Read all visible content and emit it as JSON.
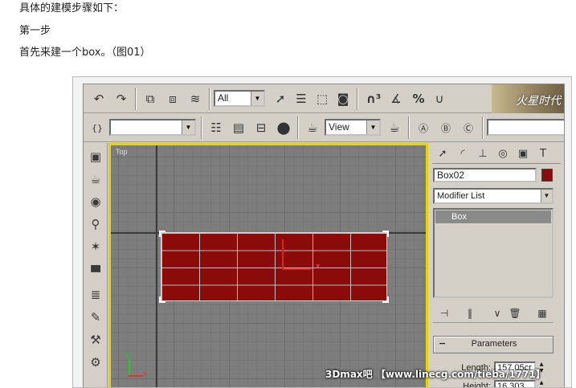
{
  "article": {
    "line1": "具体的建模步骤如下：",
    "line2": "第一步",
    "line3": "首先来建一个box。（图01）"
  },
  "toolbar1": {
    "selection_filter": "All",
    "icons": [
      "undo-icon",
      "redo-icon",
      "link-icon",
      "unlink-icon",
      "bind-space-warp-icon",
      "select-object-icon",
      "select-by-name-icon",
      "rectangular-selection-icon",
      "window-crossing-icon",
      "snap-3d-icon",
      "angle-snap-icon",
      "percent-snap-icon",
      "spinner-snap-icon"
    ],
    "logo_text": "火星时代"
  },
  "toolbar2": {
    "named_selection": "",
    "view_dropdown": "View",
    "icons": [
      "named-sets-icon",
      "layers-icon",
      "track-view-icon",
      "schematic-view-icon",
      "material-editor-icon",
      "render-scene-icon",
      "quick-render-icon",
      "named-selection-a-icon",
      "named-selection-b-icon",
      "named-selection-c-icon"
    ]
  },
  "left_strip": {
    "icons": [
      "box-primitive-icon",
      "teapot-icon",
      "sphere-icon",
      "pin-icon",
      "star-icon",
      "wall-icon",
      "stack-icon",
      "pencil-icon",
      "hammer-icon",
      "gear-icon"
    ]
  },
  "viewport": {
    "label": "Top",
    "axis_x": "x",
    "axis_y": "y",
    "pivot_label": "x"
  },
  "command_panel": {
    "tabs": [
      "create-tab-icon",
      "modify-tab-icon",
      "hierarchy-tab-icon",
      "motion-tab-icon",
      "display-tab-icon",
      "utilities-tab-icon"
    ],
    "object_name": "Box02",
    "object_color": "#8b0a0a",
    "modifier_list_label": "Modifier List",
    "stack_item": "Box",
    "parameters_title": "Parameters",
    "length_label": "Length:",
    "length_value": "157.05cr",
    "height_label": "Height:",
    "height_value": "16.303"
  },
  "watermark": "3Dmax吧 【www.linecg.com/tieba/1771】"
}
